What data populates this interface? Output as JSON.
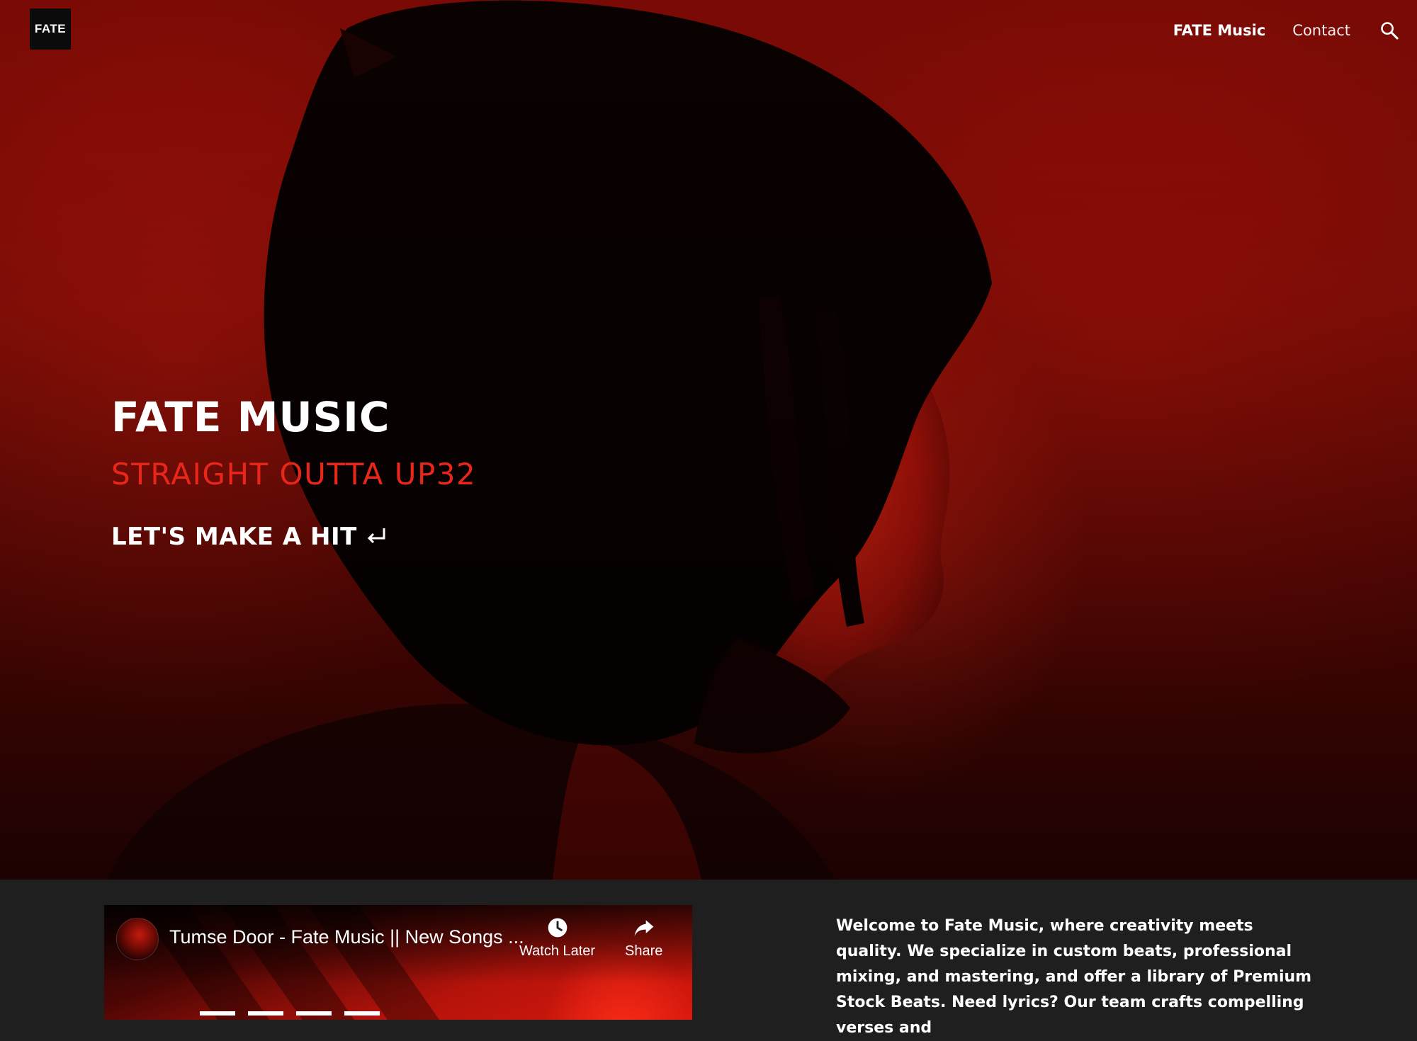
{
  "header": {
    "logo_text": "FATE",
    "nav": [
      {
        "label": "FATE Music",
        "active": true
      },
      {
        "label": "Contact",
        "active": false
      }
    ],
    "search_icon": "search-icon"
  },
  "hero": {
    "title": "FATE MUSIC",
    "subtitle": "STRAIGHT OUTTA UP32",
    "cta_label": "LET'S MAKE A HIT",
    "cta_icon": "return-arrow-icon",
    "accent_color": "#e8261a"
  },
  "video": {
    "title": "Tumse Door - Fate Music || New Songs ...",
    "watch_later_label": "Watch Later",
    "share_label": "Share"
  },
  "intro": {
    "text": "Welcome to Fate Music, where creativity meets quality. We specialize in custom beats, professional mixing, and mastering, and offer a library of Premium Stock Beats. Need lyrics? Our team crafts compelling verses and"
  }
}
